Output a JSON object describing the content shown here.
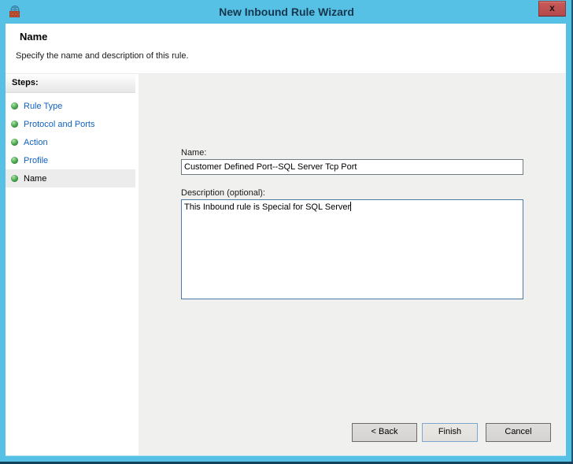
{
  "window": {
    "title": "New Inbound Rule Wizard",
    "close_label": "x"
  },
  "header": {
    "title": "Name",
    "subtitle": "Specify the name and description of this rule."
  },
  "sidebar": {
    "heading": "Steps:",
    "steps": [
      {
        "label": "Rule Type",
        "state": "done"
      },
      {
        "label": "Protocol and Ports",
        "state": "done"
      },
      {
        "label": "Action",
        "state": "done"
      },
      {
        "label": "Profile",
        "state": "done"
      },
      {
        "label": "Name",
        "state": "current"
      }
    ]
  },
  "form": {
    "name_label": "Name:",
    "name_value": "Customer Defined Port--SQL Server Tcp Port",
    "description_label": "Description (optional):",
    "description_value": "This Inbound rule is Special for SQL Server"
  },
  "buttons": {
    "back": "< Back",
    "finish": "Finish",
    "cancel": "Cancel"
  },
  "colors": {
    "titlebar_teal": "#57c0e5",
    "close_red": "#bf4f4e",
    "link_blue": "#1161be",
    "bullet_green": "#3a9340",
    "panel_gray": "#f0f0ee",
    "frame_dark": "#16415c"
  }
}
